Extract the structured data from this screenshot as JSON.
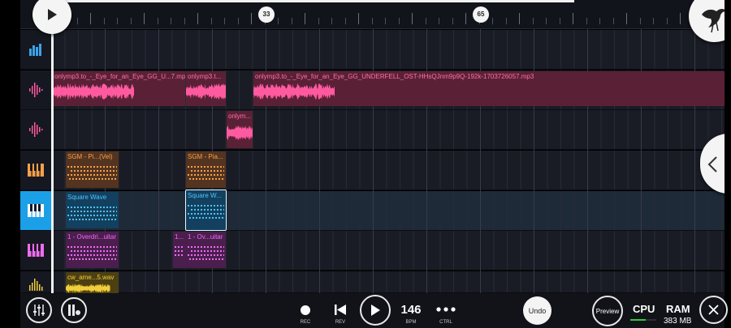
{
  "ruler": {
    "markers": [
      "33",
      "65"
    ]
  },
  "tracks": [
    {
      "id": "track-drums",
      "icon": "drum-pads-icon",
      "color": "#3aa3e8"
    },
    {
      "id": "track-audio-1",
      "icon": "audio-waveform-icon",
      "color": "#ff5aa0"
    },
    {
      "id": "track-audio-2",
      "icon": "audio-waveform-icon",
      "color": "#ff5aa0"
    },
    {
      "id": "track-piano-orange",
      "icon": "piano-keys-icon",
      "color": "#f7a04b"
    },
    {
      "id": "track-piano-blue",
      "icon": "piano-keys-icon",
      "color": "#ffffff"
    },
    {
      "id": "track-piano-magenta",
      "icon": "piano-keys-icon",
      "color": "#f06cf0"
    },
    {
      "id": "track-audio-yellow",
      "icon": "audio-waveform-icon",
      "color": "#f1cf3a"
    }
  ],
  "clips": {
    "audio1_a": "onlymp3.to_-_Eye_for_an_Eye_GG_U...7.mp3",
    "audio1_b": "onlymp3.t...",
    "audio1_c": "onlymp3.to_-_Eye_for_an_Eye_GG_UNDERFELL_OST-HHsQJnm9p9Q-192k-1703726057.mp3",
    "audio2_a": "onlym...",
    "orange_a": "SGM - Pi...(Vel)",
    "orange_b": "SGM - Pia...",
    "blue_a": "Square Wave",
    "blue_b": "Square W...",
    "magenta_a": "1 - Overdri...uitar",
    "magenta_b": "1...",
    "magenta_c": "1 - Ov...uitar",
    "yellow_a": "cw_ame...5.wav"
  },
  "bottom": {
    "rec_label": "REC",
    "rev_label": "REV",
    "bpm_value": "146",
    "bpm_label": "BPM",
    "ctrl_label": "CTRL",
    "undo_label": "Undo",
    "preview_label": "Preview",
    "cpu_label": "CPU",
    "ram_label": "RAM",
    "ram_value": "383 MB"
  },
  "colors": {
    "accent_blue": "#1ba0e8",
    "audio_pink": "#ff5aa0",
    "orange": "#f7a04b",
    "magenta": "#f06cf0",
    "yellow": "#f1cf3a",
    "cpu_meter": "#2ecc40"
  }
}
